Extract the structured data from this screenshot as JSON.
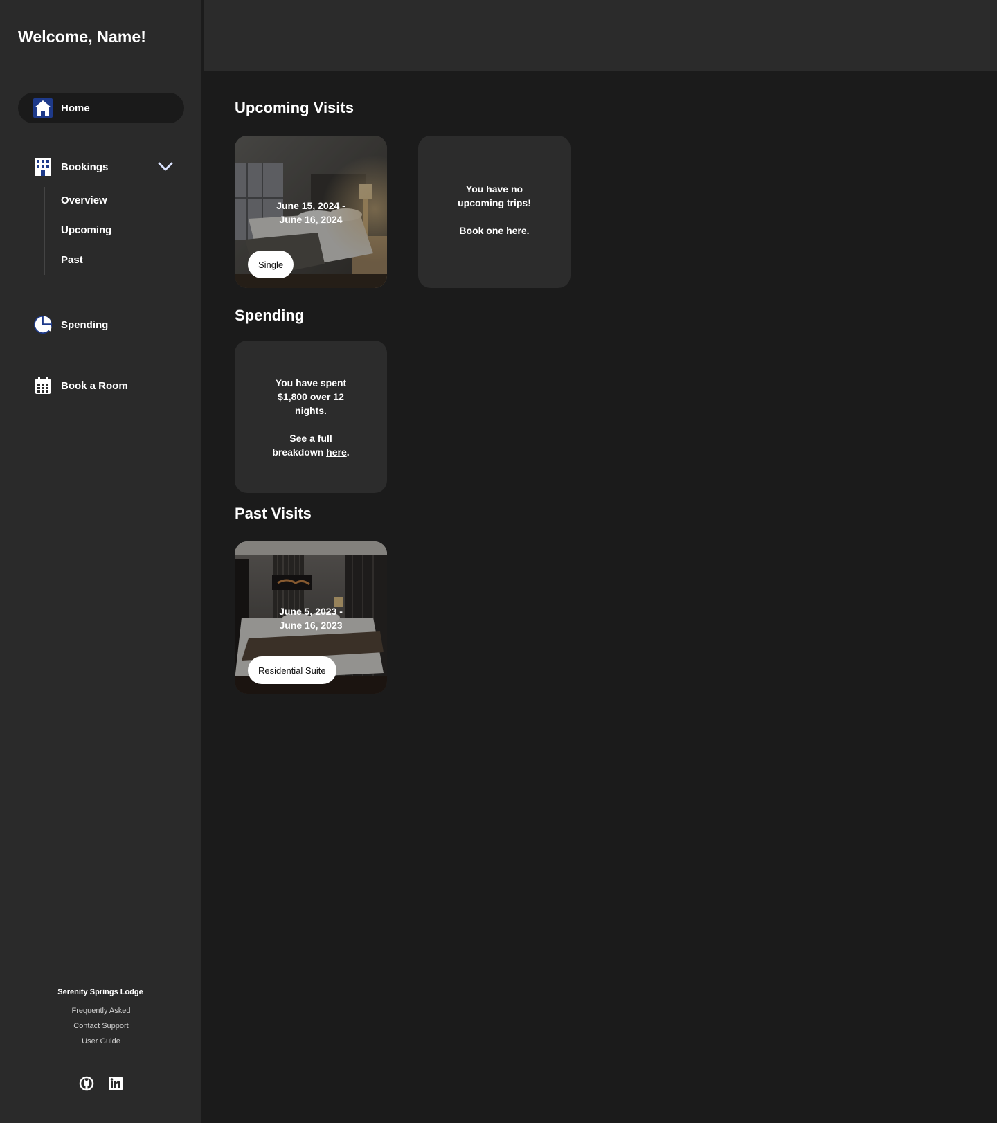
{
  "sidebar": {
    "welcome": "Welcome, Name!",
    "nav": {
      "home": "Home",
      "bookings": "Bookings",
      "spending": "Spending",
      "book_room": "Book a Room"
    },
    "bookings_sub": {
      "overview": "Overview",
      "upcoming": "Upcoming",
      "past": "Past"
    },
    "footer": {
      "title": "Serenity Springs Lodge",
      "links": [
        "Frequently Asked",
        "Contact Support",
        "User Guide"
      ]
    },
    "icons": {
      "home": "home-icon",
      "bookings": "hotel-icon",
      "chevron": "chevron-down-icon",
      "spending": "pie-chart-icon",
      "book_room": "calendar-icon",
      "github": "github-icon",
      "linkedin": "linkedin-icon"
    }
  },
  "main": {
    "upcoming": {
      "title": "Upcoming Visits",
      "card1": {
        "dates_line1": "June 15, 2024 -",
        "dates_line2": "June 16, 2024",
        "room": "Single"
      },
      "card2": {
        "line1": "You have no",
        "line2": "upcoming trips!",
        "cta_prefix": "Book one ",
        "cta_link": "here",
        "cta_suffix": "."
      }
    },
    "spending": {
      "title": "Spending",
      "line1": "You have spent",
      "line2": "$1,800 over 12",
      "line3": "nights.",
      "line4": "See a full",
      "line5_prefix": "breakdown ",
      "line5_link": "here",
      "line5_suffix": "."
    },
    "past": {
      "title": "Past Visits",
      "card1": {
        "dates_line1": "June 5, 2023 -",
        "dates_line2": "June 16, 2023",
        "room": "Residential Suite"
      }
    }
  },
  "colors": {
    "page_bg": "#1b1b1b",
    "sidebar_bg": "#2a2a2a",
    "topbar_bg": "#2b2b2b",
    "card_bg": "#2c2c2c",
    "active_nav_bg": "#1a1a1a",
    "icon_accent": "#1e3a8a"
  }
}
